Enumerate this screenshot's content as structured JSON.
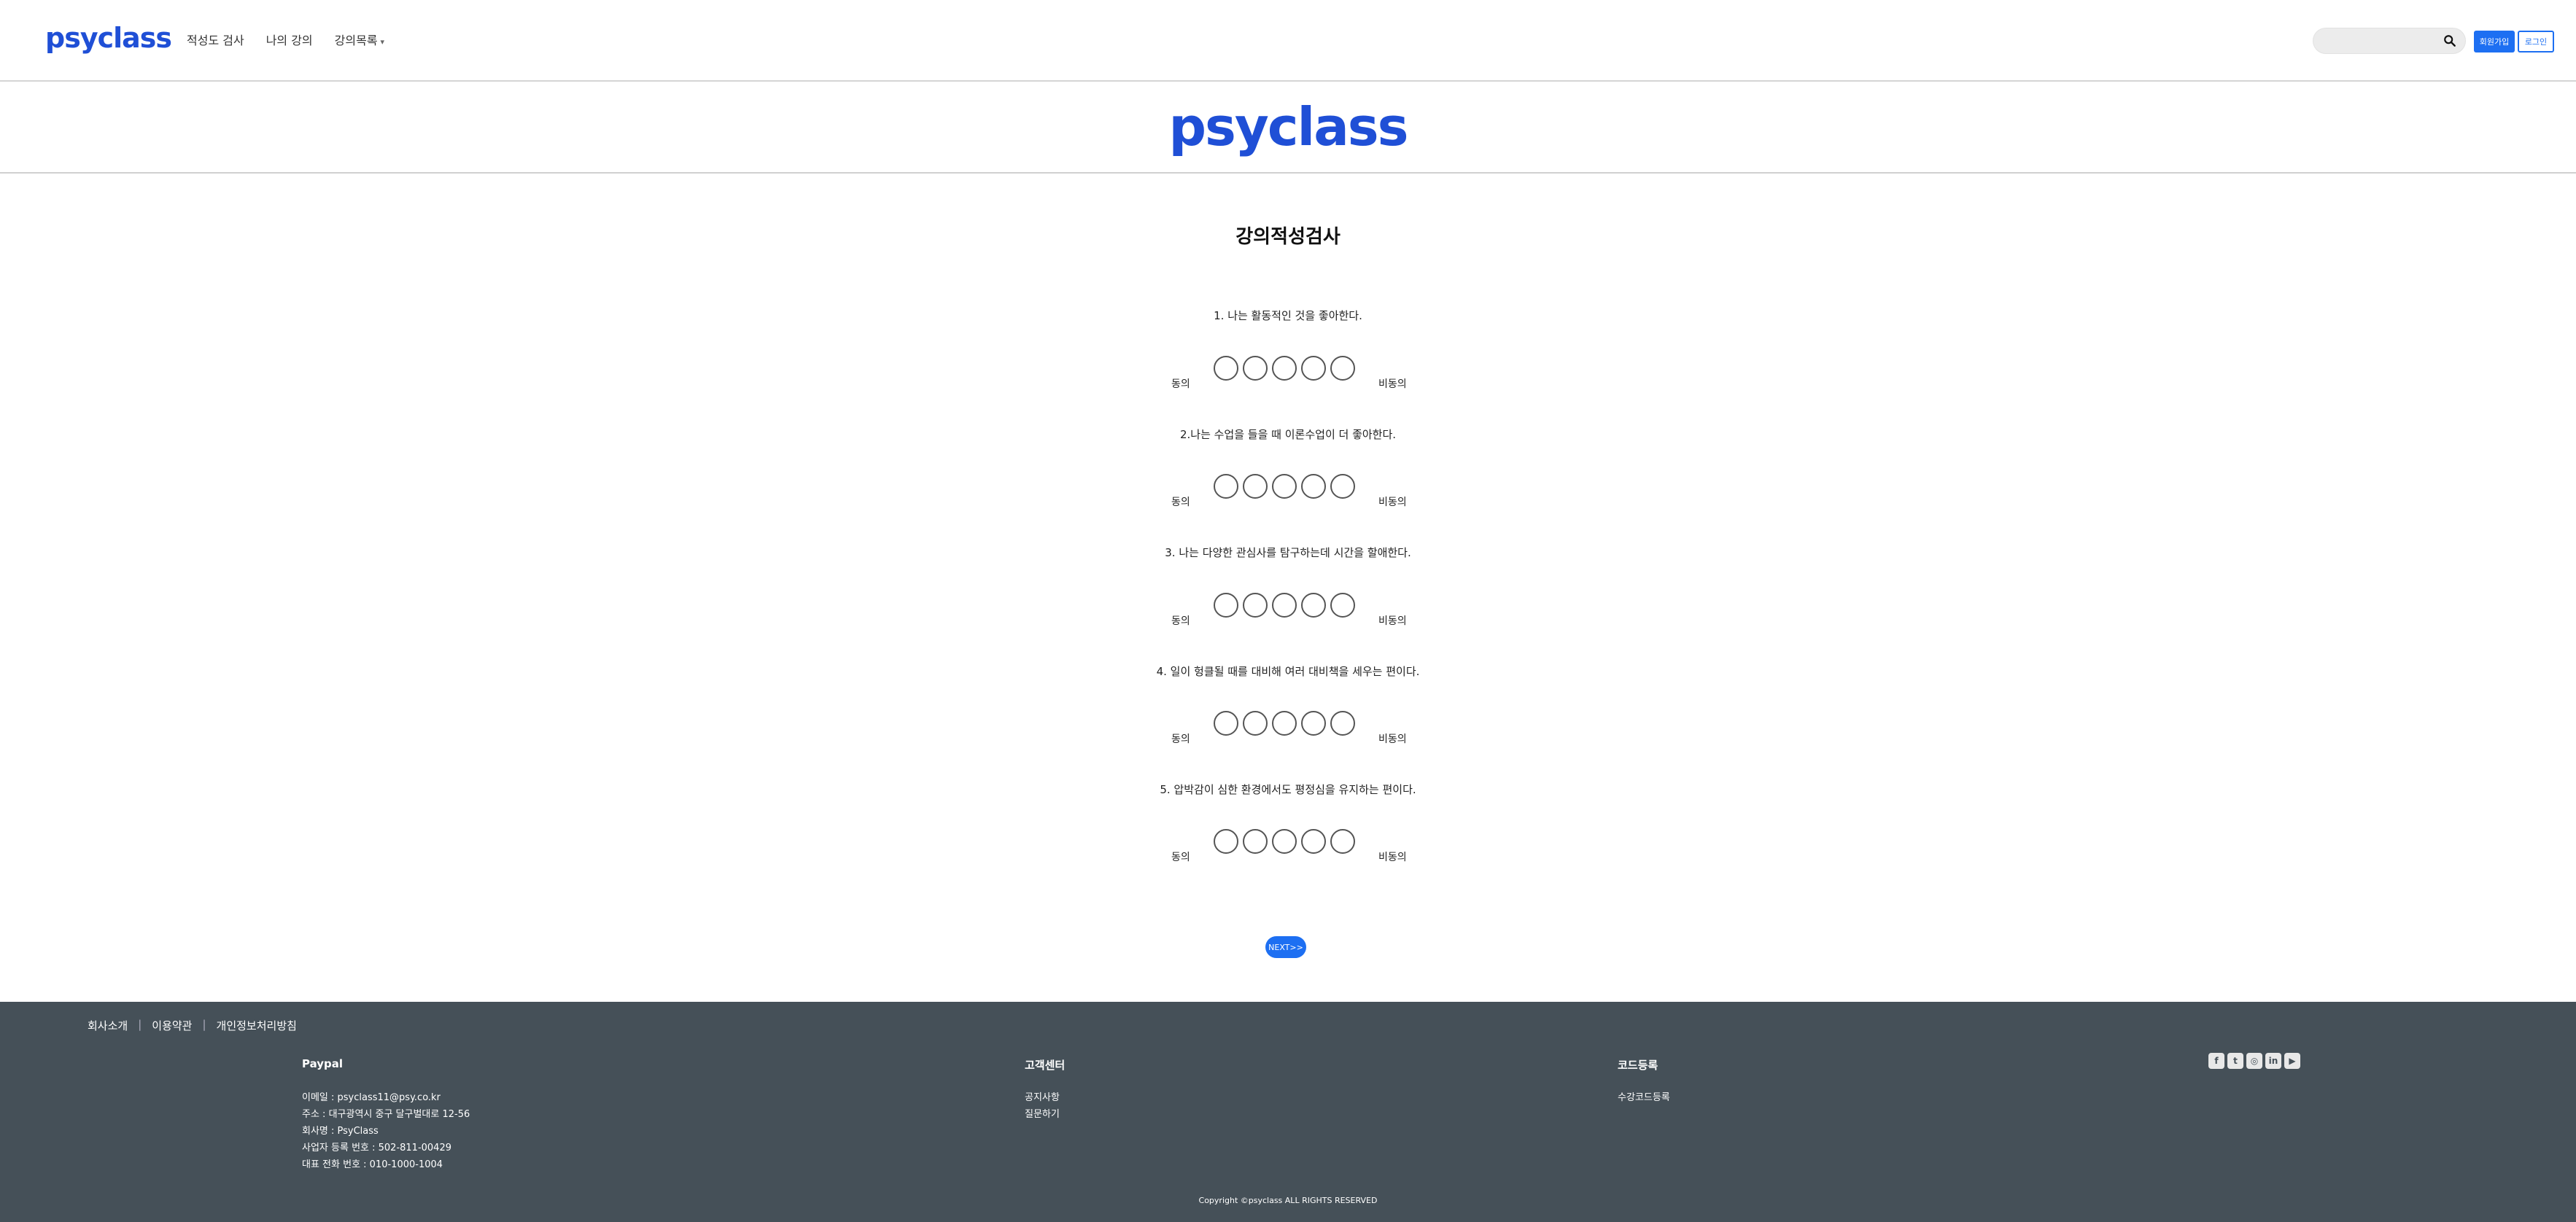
{
  "nav": {
    "logo": "psyclass",
    "links": [
      {
        "label": "적성도 검사"
      },
      {
        "label": "나의 강의"
      },
      {
        "label": "강의목록"
      }
    ],
    "search_placeholder": "",
    "signup_label": "회원가입",
    "login_label": "로그인"
  },
  "banner": {
    "logo": "psyclass"
  },
  "survey": {
    "title": "강의적성검사",
    "left_label": "동의",
    "right_label": "비동의",
    "questions": [
      {
        "text": "1. 나는 활동적인 것을 좋아한다."
      },
      {
        "text": "2.나는 수업을 들을 때 이론수업이 더 좋아한다."
      },
      {
        "text": "3. 나는 다양한 관심사를 탐구하는데 시간을 할애한다."
      },
      {
        "text": "4. 일이 헝클될 때를 대비해 여러 대비책을 세우는 편이다."
      },
      {
        "text": "5. 압박감이 심한 환경에서도 평정심을 유지하는 편이다."
      }
    ],
    "next_label": "NEXT>>"
  },
  "footer": {
    "links": [
      "회사소개",
      "이용약관",
      "개인정보처리방침"
    ],
    "company": {
      "title": "Paypal",
      "lines": [
        "이메일 : psyclass11@psy.co.kr",
        "주소 : 대구광역시 중구 달구벌대로 12-56",
        "회사명 : PsyClass",
        "사업자 등록 번호 : 502-811-00429",
        "대표 전화 번호 : 010-1000-1004"
      ]
    },
    "support": {
      "title": "고객센터",
      "lines": [
        "공지사항",
        "질문하기"
      ]
    },
    "code": {
      "title": "코드등록",
      "lines": [
        "수강코드등록"
      ]
    },
    "social_icons": [
      {
        "name": "facebook-icon",
        "glyph": "f"
      },
      {
        "name": "twitter-icon",
        "glyph": "t"
      },
      {
        "name": "instagram-icon",
        "glyph": "◎"
      },
      {
        "name": "linkedin-icon",
        "glyph": "in"
      },
      {
        "name": "youtube-icon",
        "glyph": "▶"
      }
    ],
    "copyright": "Copyright ©psyclass ALL RIGHTS RESERVED"
  },
  "colors": {
    "brand": "#1f4fd6",
    "button": "#1d6ff2",
    "footer": "#455058"
  }
}
